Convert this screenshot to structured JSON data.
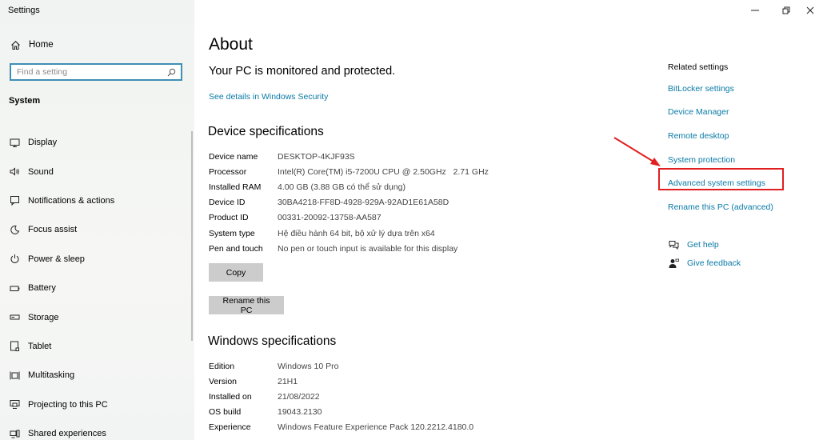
{
  "window": {
    "title": "Settings"
  },
  "sidebar": {
    "home": {
      "label": "Home",
      "icon": "home-icon"
    },
    "search": {
      "placeholder": "Find a setting",
      "icon": "search-icon"
    },
    "section_title": "System",
    "items": [
      {
        "label": "Display",
        "icon": "display-icon"
      },
      {
        "label": "Sound",
        "icon": "sound-icon"
      },
      {
        "label": "Notifications & actions",
        "icon": "notifications-icon"
      },
      {
        "label": "Focus assist",
        "icon": "focus-assist-icon"
      },
      {
        "label": "Power & sleep",
        "icon": "power-icon"
      },
      {
        "label": "Battery",
        "icon": "battery-icon"
      },
      {
        "label": "Storage",
        "icon": "storage-icon"
      },
      {
        "label": "Tablet",
        "icon": "tablet-icon"
      },
      {
        "label": "Multitasking",
        "icon": "multitasking-icon"
      },
      {
        "label": "Projecting to this PC",
        "icon": "projecting-icon"
      },
      {
        "label": "Shared experiences",
        "icon": "shared-experiences-icon"
      }
    ]
  },
  "main": {
    "title": "About",
    "protection_status": "Your PC is monitored and protected.",
    "security_link": "See details in Windows Security",
    "device_specs": {
      "heading": "Device specifications",
      "rows": [
        {
          "label": "Device name",
          "value": "DESKTOP-4KJF93S"
        },
        {
          "label": "Processor",
          "value": "Intel(R) Core(TM) i5-7200U CPU @ 2.50GHz   2.71 GHz"
        },
        {
          "label": "Installed RAM",
          "value": "4.00 GB (3.88 GB có thể sử dụng)"
        },
        {
          "label": "Device ID",
          "value": "30BA4218-FF8D-4928-929A-92AD1E61A58D"
        },
        {
          "label": "Product ID",
          "value": "00331-20092-13758-AA587"
        },
        {
          "label": "System type",
          "value": "Hệ điều hành 64 bit, bộ xử lý dựa trên x64"
        },
        {
          "label": "Pen and touch",
          "value": "No pen or touch input is available for this display"
        }
      ],
      "copy_button": "Copy",
      "rename_button": "Rename this PC"
    },
    "windows_specs": {
      "heading": "Windows specifications",
      "rows": [
        {
          "label": "Edition",
          "value": "Windows 10 Pro"
        },
        {
          "label": "Version",
          "value": "21H1"
        },
        {
          "label": "Installed on",
          "value": "21/08/2022"
        },
        {
          "label": "OS build",
          "value": "19043.2130"
        },
        {
          "label": "Experience",
          "value": "Windows Feature Experience Pack 120.2212.4180.0"
        }
      ]
    }
  },
  "related": {
    "title": "Related settings",
    "links": [
      "BitLocker settings",
      "Device Manager",
      "Remote desktop",
      "System protection",
      "Advanced system settings",
      "Rename this PC (advanced)"
    ],
    "highlighted_link": "Advanced system settings",
    "highlight_color": "#e02020"
  },
  "help": {
    "get_help": "Get help",
    "give_feedback": "Give feedback"
  },
  "colors": {
    "link": "#0a7aa6",
    "search_border": "#3e8fb7",
    "button": "#cccccc"
  }
}
